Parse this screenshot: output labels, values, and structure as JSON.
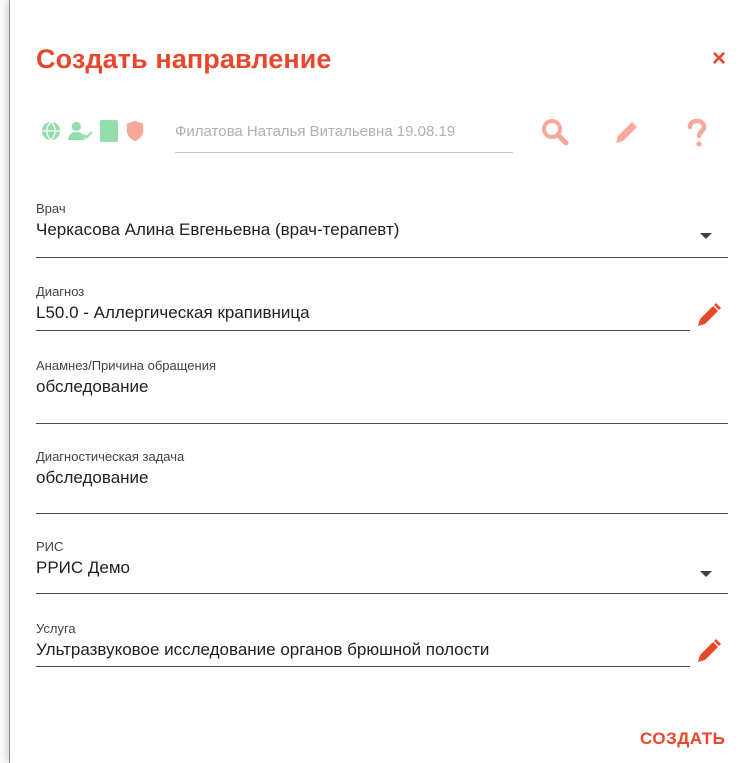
{
  "dialog": {
    "title": "Создать направление",
    "close_label": "×",
    "accent_color": "#e8472b"
  },
  "patient_bar": {
    "icons": [
      "globe-icon",
      "user-check-icon",
      "card-icon",
      "shield-icon"
    ],
    "patient_value": "Филатова Наталья Витальевна 19.08.19",
    "actions": [
      "search-icon",
      "pencil-icon",
      "help-icon"
    ],
    "icon_colors": {
      "green": "#3ec46d",
      "red": "#f0624a"
    }
  },
  "form": {
    "doctor": {
      "label": "Врач",
      "value": "Черкасова Алина Евгеньевна (врач-терапевт)"
    },
    "diagnosis": {
      "label": "Диагноз",
      "value": "L50.0 - Аллергическая крапивница"
    },
    "anamnesis": {
      "label": "Анамнез/Причина обращения",
      "value": "обследование"
    },
    "diagnostic_task": {
      "label": "Диагностическая задача",
      "value": "обследование"
    },
    "ris": {
      "label": "РИС",
      "value": "РРИС Демо"
    },
    "service": {
      "label": "Услуга",
      "value": "Ультразвуковое исследование органов брюшной полости"
    }
  },
  "footer": {
    "create_label": "СОЗДАТЬ"
  }
}
